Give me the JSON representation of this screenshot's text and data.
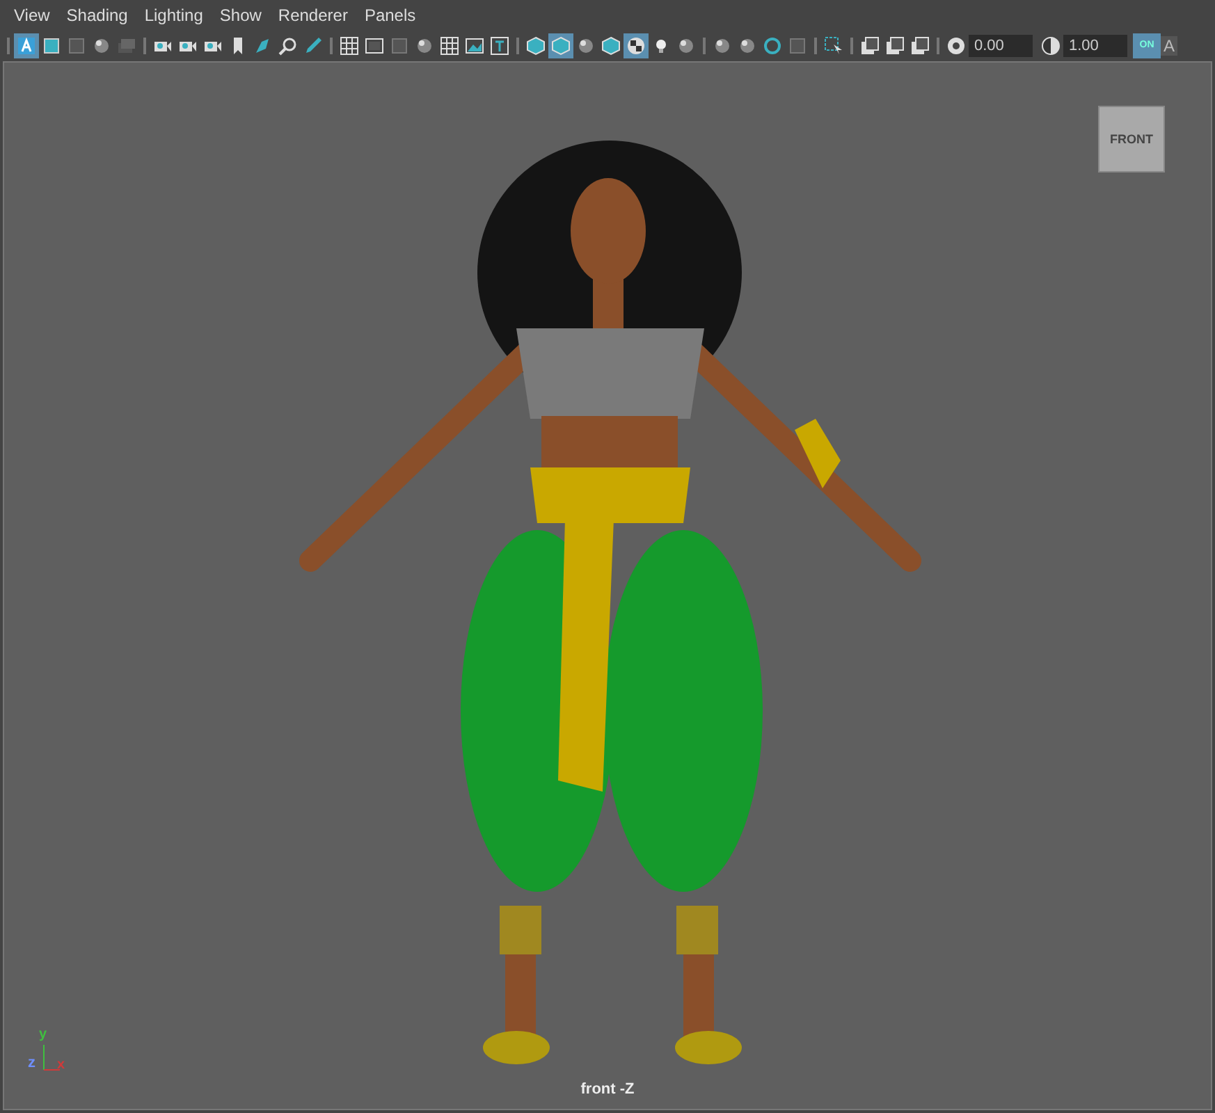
{
  "menu": [
    "View",
    "Shading",
    "Lighting",
    "Show",
    "Renderer",
    "Panels"
  ],
  "toolbar": {
    "groups": [
      {
        "buttons": [
          {
            "selected": true
          },
          {
            "selected": false
          },
          {
            "selected": false
          },
          {
            "selected": false
          },
          {
            "selected": false
          }
        ]
      },
      {
        "buttons": [
          {
            "selected": false
          },
          {
            "selected": false
          },
          {
            "selected": false
          },
          {
            "selected": false
          },
          {
            "selected": false
          },
          {
            "selected": false
          },
          {
            "selected": false
          }
        ]
      },
      {
        "buttons": [
          {
            "selected": false
          },
          {
            "selected": false
          },
          {
            "selected": false
          },
          {
            "selected": false
          },
          {
            "selected": false
          },
          {
            "selected": false
          },
          {
            "selected": false
          }
        ]
      },
      {
        "buttons": [
          {
            "selected": false
          },
          {
            "selected": true
          },
          {
            "selected": false
          },
          {
            "selected": false
          },
          {
            "selected": true
          },
          {
            "selected": false
          },
          {
            "selected": false
          }
        ]
      },
      {
        "buttons": [
          {
            "selected": false
          },
          {
            "selected": false
          },
          {
            "selected": false
          },
          {
            "selected": false
          }
        ]
      },
      {
        "buttons": [
          {
            "selected": false
          }
        ]
      },
      {
        "buttons": [
          {
            "selected": false
          },
          {
            "selected": false
          },
          {
            "selected": false
          }
        ]
      }
    ],
    "exposure": "0.00",
    "gamma": "1.00",
    "color_management": {
      "label": "ON",
      "on": true
    },
    "overflow_label": "A"
  },
  "viewport": {
    "view_cube": "FRONT",
    "camera_label": "front -Z",
    "axes": [
      {
        "label": "y",
        "color": "#3fbf3f"
      },
      {
        "label": "z",
        "color": "#6f8fff"
      },
      {
        "label": "x",
        "color": "#d03a3a"
      }
    ]
  }
}
